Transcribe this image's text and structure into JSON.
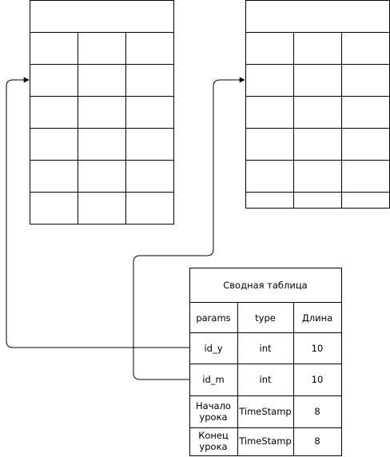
{
  "diagram": {
    "left_table": {
      "title": "",
      "rows": [
        [
          "",
          "",
          ""
        ],
        [
          "",
          "",
          ""
        ],
        [
          "",
          "",
          ""
        ],
        [
          "",
          "",
          ""
        ],
        [
          "",
          "",
          ""
        ],
        [
          "",
          "",
          ""
        ]
      ]
    },
    "right_table": {
      "title": "",
      "rows": [
        [
          "",
          "",
          ""
        ],
        [
          "",
          "",
          ""
        ],
        [
          "",
          "",
          ""
        ],
        [
          "",
          "",
          ""
        ],
        [
          "",
          "",
          ""
        ],
        [
          "",
          "",
          ""
        ]
      ]
    },
    "summary_table": {
      "title": "Сводная таблица",
      "header": [
        "params",
        "type",
        "Длина"
      ],
      "rows": [
        [
          [
            "id_y"
          ],
          [
            "int"
          ],
          [
            "10"
          ]
        ],
        [
          [
            "id_m"
          ],
          [
            "int"
          ],
          [
            "10"
          ]
        ],
        [
          [
            "Начало",
            "урока"
          ],
          [
            "TimeStamp"
          ],
          [
            "8"
          ]
        ],
        [
          [
            "Конец",
            "урока"
          ],
          [
            "TimeStamp"
          ],
          [
            "8"
          ]
        ]
      ]
    },
    "connectors": [
      {
        "from": "summary_table.row.id_y",
        "to": "left_table.row.2"
      },
      {
        "from": "summary_table.row.id_m",
        "to": "right_table.row.2"
      }
    ],
    "stroke_color": "#000000",
    "background_color": "#ffffff"
  }
}
